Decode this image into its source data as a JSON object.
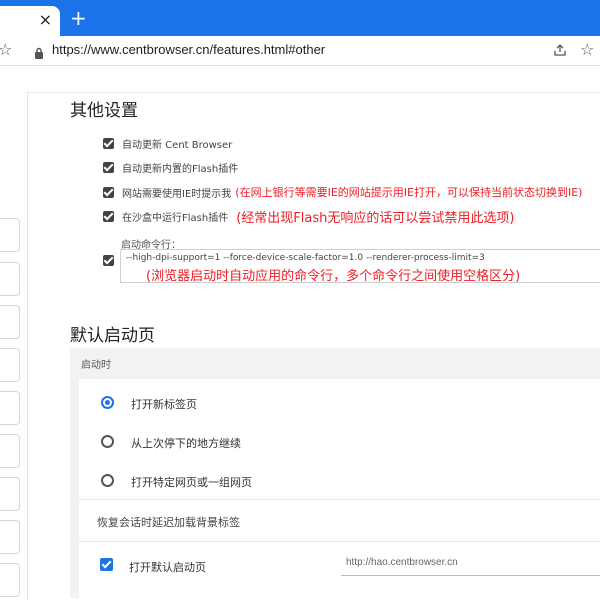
{
  "browser": {
    "tab_close": "×",
    "new_tab": "+",
    "url": "https://www.centbrowser.cn/features.html#other"
  },
  "other_settings": {
    "title": "其他设置",
    "options": [
      {
        "label": "自动更新 Cent Browser",
        "note": ""
      },
      {
        "label": "自动更新内置的Flash插件",
        "note": ""
      },
      {
        "label": "网站需要使用IE时提示我",
        "note": "(在网上银行等需要IE的网站提示用IE打开，可以保持当前状态切换到IE)"
      },
      {
        "label": "在沙盒中运行Flash插件",
        "note": "(经常出现Flash无响应的话可以尝试禁用此选项)"
      }
    ],
    "command_label": "启动命令行：",
    "command_value": "--high-dpi-support=1 --force-device-scale-factor=1.0 --renderer-process-limit=3",
    "command_note": "(浏览器启动时自动应用的命令行，多个命令行之间使用空格区分)"
  },
  "startup": {
    "title": "默认启动页",
    "panel_title": "启动时",
    "options": [
      {
        "label": "打开新标签页",
        "selected": true
      },
      {
        "label": "从上次停下的地方继续",
        "selected": false
      },
      {
        "label": "打开特定网页或一组网页",
        "selected": false
      }
    ],
    "delay_label": "恢复会话时延迟加载背景标签",
    "default_label": "打开默认启动页",
    "default_url": "http://hao.centbrowser.cn"
  },
  "colors": {
    "accent": "#1a73e8",
    "note": "#ee1d24"
  }
}
